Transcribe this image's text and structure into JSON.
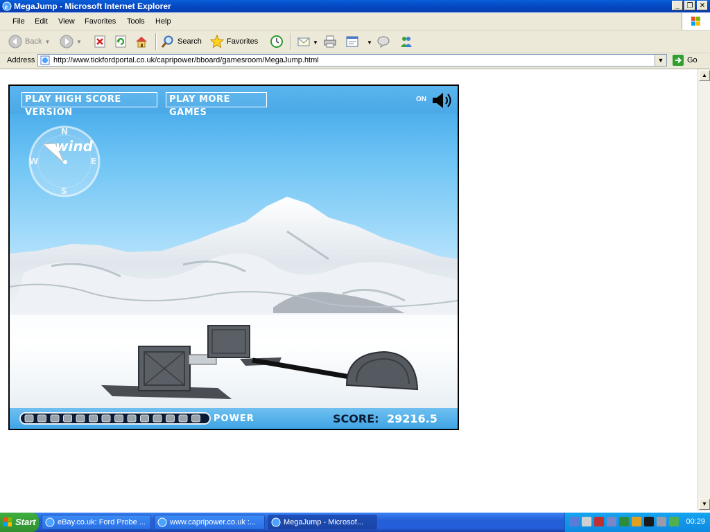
{
  "window": {
    "title": "MegaJump - Microsoft Internet Explorer"
  },
  "menu": {
    "items": [
      "File",
      "Edit",
      "View",
      "Favorites",
      "Tools",
      "Help"
    ]
  },
  "toolbar": {
    "back_label": "Back",
    "search_label": "Search",
    "favorites_label": "Favorites"
  },
  "address": {
    "label": "Address",
    "url": "http://www.tickfordportal.co.uk/capripower/bboard/gamesroom/MegaJump.html",
    "go_label": "Go"
  },
  "game": {
    "high_score_button": "PLAY HIGH SCORE VERSION",
    "more_games_button": "PLAY MORE GAMES",
    "sound_state": "ON",
    "compass": {
      "n": "N",
      "e": "E",
      "s": "S",
      "w": "W",
      "label": "wind"
    },
    "power_label": "POWER",
    "score_label": "SCORE:",
    "score_value": "29216.5",
    "power_level": 0
  },
  "taskbar": {
    "start_label": "Start",
    "tasks": [
      {
        "label": "eBay.co.uk: Ford Probe ..."
      },
      {
        "label": "www.capripower.co.uk :..."
      },
      {
        "label": "MegaJump - Microsof..."
      }
    ],
    "clock": "00:29"
  },
  "colors": {
    "titlebar": "#0348c4",
    "sky": "#3aa2e6",
    "taskbar": "#245edb",
    "start": "#2f8f2f"
  }
}
